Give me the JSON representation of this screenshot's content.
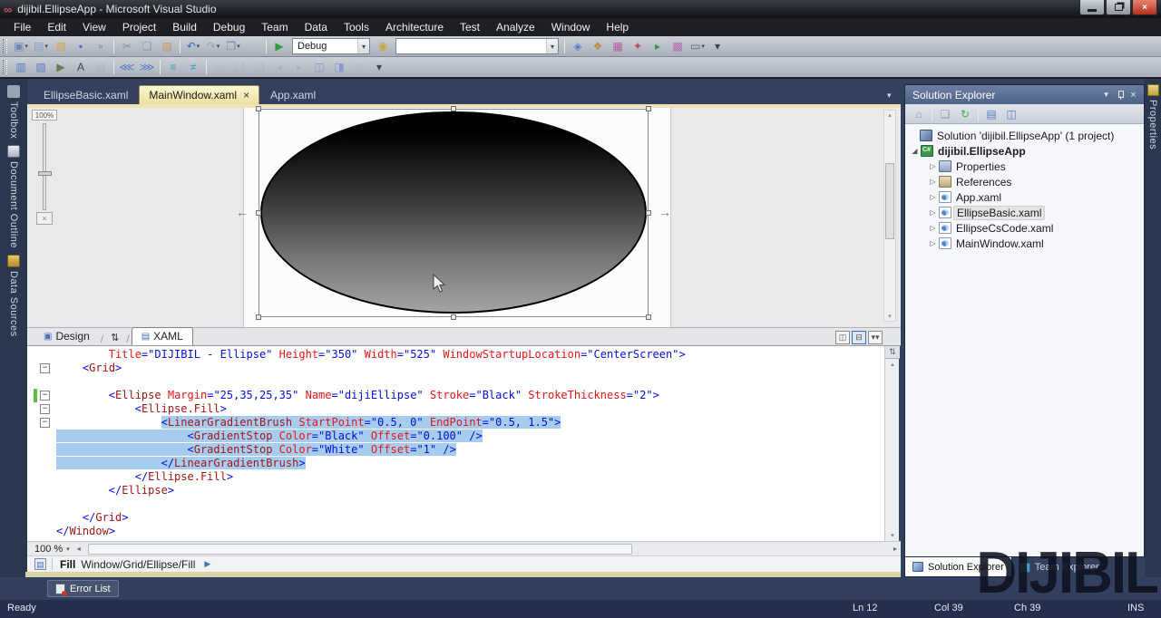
{
  "titlebar": {
    "title": "dijibil.EllipseApp - Microsoft Visual Studio"
  },
  "glyphs": {
    "vs_logo": "∞",
    "close": "×",
    "dropdown": "▾",
    "up": "▴",
    "down": "▾",
    "left": "◂",
    "right": "▸",
    "swap": "⇅",
    "fold_minus": "−",
    "expander_expanded": "◢",
    "expander_collapsed": "▷",
    "breadcrumb_play": "▶",
    "arrow_left": "←",
    "arrow_right": "→",
    "doc_dropdown": "▾",
    "split_vertical": "◫",
    "split_horizontal": "⊟",
    "collapse_pane": "▾▾",
    "fit_view": "×",
    "breadcrumb_doc": "▤",
    "resize_grip": "≡"
  },
  "menu": {
    "items": [
      "File",
      "Edit",
      "View",
      "Project",
      "Build",
      "Debug",
      "Team",
      "Data",
      "Tools",
      "Architecture",
      "Test",
      "Analyze",
      "Window",
      "Help"
    ]
  },
  "toolbar1": {
    "icons_left": [
      {
        "name": "new-project-icon",
        "g": "▣",
        "c": "#6f87b8",
        "dd": true
      },
      {
        "name": "add-item-icon",
        "g": "▤",
        "c": "#8a9ec4",
        "dd": true
      },
      {
        "name": "open-file-icon",
        "g": "▨",
        "c": "#d9a741"
      },
      {
        "name": "save-icon",
        "g": "▪",
        "c": "#4a6fb5"
      },
      {
        "name": "save-all-icon",
        "g": "▫",
        "c": "#4a6fb5"
      },
      {
        "sep": true
      },
      {
        "name": "cut-icon",
        "g": "✂",
        "c": "#7d8aa8"
      },
      {
        "name": "copy-icon",
        "g": "❏",
        "c": "#8a97b5"
      },
      {
        "name": "paste-icon",
        "g": "▧",
        "c": "#c49a5a"
      },
      {
        "sep": true
      },
      {
        "name": "undo-icon",
        "g": "↶",
        "c": "#3d63c2",
        "dd": true
      },
      {
        "name": "redo-icon",
        "g": "↷",
        "c": "#9aa5bd",
        "dd": true
      },
      {
        "name": "navigate-window-icon",
        "g": "❒",
        "c": "#6f87b8",
        "dd": true
      },
      {
        "name": "new-window-icon",
        "g": "❑",
        "c": "#b0b8c8",
        "d": true
      },
      {
        "sep": true
      },
      {
        "name": "start-debug-icon",
        "g": "▶",
        "c": "#2f9e3f"
      }
    ],
    "debug_combo": {
      "value": "Debug"
    },
    "find_icon": {
      "name": "find-symbol-icon",
      "g": "◉",
      "c": "#caa53f"
    },
    "search_combo": {
      "value": ""
    },
    "icons_right": [
      {
        "sep": true
      },
      {
        "name": "find-in-files-icon",
        "g": "◈",
        "c": "#5a7ec2"
      },
      {
        "name": "solution-explorer-icon",
        "g": "❖",
        "c": "#c08a3e"
      },
      {
        "name": "properties-window-icon",
        "g": "▦",
        "c": "#b55a9e"
      },
      {
        "name": "object-browser-icon",
        "g": "✦",
        "c": "#c2485a"
      },
      {
        "name": "start-page-icon",
        "g": "▸",
        "c": "#2f9e3f"
      },
      {
        "name": "extension-manager-icon",
        "g": "▩",
        "c": "#b56ab5"
      },
      {
        "name": "command-window-icon",
        "g": "▭",
        "c": "#5a6478",
        "dd": true
      },
      {
        "name": "toolbar-overflow-icon",
        "g": "▾",
        "c": "#3a4152"
      }
    ]
  },
  "toolbar2": {
    "icons": [
      {
        "name": "format-document-icon",
        "g": "▥",
        "c": "#5a7ec2"
      },
      {
        "name": "format-selection-icon",
        "g": "▧",
        "c": "#5a7ec2"
      },
      {
        "name": "pointer-icon",
        "g": "▶",
        "c": "#6a7a52"
      },
      {
        "name": "font-style-icon",
        "g": "A",
        "c": "#3a4152"
      },
      {
        "name": "copy-format-icon",
        "g": "▤",
        "c": "#9aa5bd",
        "d": true
      },
      {
        "sep": true
      },
      {
        "name": "indent-decrease-icon",
        "g": "⋘",
        "c": "#5a7ec2"
      },
      {
        "name": "indent-increase-icon",
        "g": "⋙",
        "c": "#5a7ec2"
      },
      {
        "sep": true
      },
      {
        "name": "comment-icon",
        "g": "≡",
        "c": "#3d9ec2"
      },
      {
        "name": "uncomment-icon",
        "g": "≠",
        "c": "#3d9ec2"
      },
      {
        "sep": true
      },
      {
        "name": "display-preview-icon",
        "g": "▭",
        "c": "#9aa5bd",
        "d": true
      },
      {
        "name": "balloon-1-icon",
        "g": "❏",
        "c": "#9aa5bd",
        "d": true
      },
      {
        "name": "balloon-2-icon",
        "g": "❑",
        "c": "#9aa5bd",
        "d": true
      },
      {
        "name": "navigate-back-icon",
        "g": "◂",
        "c": "#9aa5bd",
        "d": true
      },
      {
        "name": "navigate-forward-icon",
        "g": "▸",
        "c": "#9aa5bd",
        "d": true
      },
      {
        "name": "previous-bookmark-icon",
        "g": "◫",
        "c": "#8a97d0"
      },
      {
        "name": "next-bookmark-icon",
        "g": "◨",
        "c": "#8a97d0"
      },
      {
        "name": "clear-bookmarks-icon",
        "g": "◎",
        "c": "#9aa5bd",
        "d": true
      },
      {
        "name": "toolbar-overflow-icon",
        "g": "▾",
        "c": "#3a4152"
      }
    ]
  },
  "doc_tabs": {
    "tabs": [
      {
        "label": "EllipseBasic.xaml",
        "active": false
      },
      {
        "label": "MainWindow.xaml",
        "active": true,
        "closable": true
      },
      {
        "label": "App.xaml",
        "active": false
      }
    ]
  },
  "left_panel_tabs": [
    {
      "label": "Toolbox",
      "icon": "toolbox-icon"
    },
    {
      "label": "Document Outline",
      "icon": "document-outline-icon"
    },
    {
      "label": "Data Sources",
      "icon": "data-sources-icon"
    }
  ],
  "right_panel_tabs": [
    {
      "label": "Properties",
      "icon": "properties-icon"
    }
  ],
  "designer": {
    "zoom_label": "100%"
  },
  "editor_tabs": {
    "design_label": "Design",
    "xaml_label": "XAML"
  },
  "editor": {
    "zoom_value": "100 %",
    "lines": [
      {
        "indent": 8,
        "tokens": [
          [
            "a",
            "Title"
          ],
          [
            "d",
            "="
          ],
          [
            "v",
            "\"DIJIBIL - Ellipse\""
          ],
          [
            "p",
            " "
          ],
          [
            "a",
            "Height"
          ],
          [
            "d",
            "="
          ],
          [
            "v",
            "\"350\""
          ],
          [
            "p",
            " "
          ],
          [
            "a",
            "Width"
          ],
          [
            "d",
            "="
          ],
          [
            "v",
            "\"525\""
          ],
          [
            "p",
            " "
          ],
          [
            "a",
            "WindowStartupLocation"
          ],
          [
            "d",
            "="
          ],
          [
            "v",
            "\"CenterScreen\""
          ],
          [
            "d",
            ">"
          ]
        ]
      },
      {
        "indent": 4,
        "fold": true,
        "tokens": [
          [
            "d",
            "<"
          ],
          [
            "t",
            "Grid"
          ],
          [
            "d",
            ">"
          ]
        ]
      },
      {
        "indent": 0,
        "tokens": []
      },
      {
        "indent": 8,
        "fold": true,
        "change": true,
        "tokens": [
          [
            "d",
            "<"
          ],
          [
            "t",
            "Ellipse"
          ],
          [
            "p",
            " "
          ],
          [
            "a",
            "Margin"
          ],
          [
            "d",
            "="
          ],
          [
            "v",
            "\"25,35,25,35\""
          ],
          [
            "p",
            " "
          ],
          [
            "a",
            "Name"
          ],
          [
            "d",
            "="
          ],
          [
            "v",
            "\"dijiEllipse\""
          ],
          [
            "p",
            " "
          ],
          [
            "a",
            "Stroke"
          ],
          [
            "d",
            "="
          ],
          [
            "v",
            "\"Black\""
          ],
          [
            "p",
            " "
          ],
          [
            "a",
            "StrokeThickness"
          ],
          [
            "d",
            "="
          ],
          [
            "v",
            "\"2\""
          ],
          [
            "d",
            ">"
          ]
        ]
      },
      {
        "indent": 12,
        "fold": true,
        "tokens": [
          [
            "d",
            "<"
          ],
          [
            "t",
            "Ellipse.Fill"
          ],
          [
            "d",
            ">"
          ]
        ]
      },
      {
        "indent": 16,
        "fold": true,
        "sel": "text",
        "tokens": [
          [
            "d",
            "<"
          ],
          [
            "t",
            "LinearGradientBrush"
          ],
          [
            "p",
            " "
          ],
          [
            "a",
            "StartPoint"
          ],
          [
            "d",
            "="
          ],
          [
            "v",
            "\"0.5, 0\""
          ],
          [
            "p",
            " "
          ],
          [
            "a",
            "EndPoint"
          ],
          [
            "d",
            "="
          ],
          [
            "v",
            "\"0.5, 1.5\""
          ],
          [
            "d",
            ">"
          ]
        ]
      },
      {
        "indent": 20,
        "sel": "line",
        "tokens": [
          [
            "d",
            "<"
          ],
          [
            "t",
            "GradientStop"
          ],
          [
            "p",
            " "
          ],
          [
            "a",
            "Color"
          ],
          [
            "d",
            "="
          ],
          [
            "v",
            "\"Black\""
          ],
          [
            "p",
            " "
          ],
          [
            "a",
            "Offset"
          ],
          [
            "d",
            "="
          ],
          [
            "v",
            "\"0.100\""
          ],
          [
            "p",
            " "
          ],
          [
            "d",
            "/>"
          ]
        ]
      },
      {
        "indent": 20,
        "sel": "line",
        "tokens": [
          [
            "d",
            "<"
          ],
          [
            "t",
            "GradientStop"
          ],
          [
            "p",
            " "
          ],
          [
            "a",
            "Color"
          ],
          [
            "d",
            "="
          ],
          [
            "v",
            "\"White\""
          ],
          [
            "p",
            " "
          ],
          [
            "a",
            "Offset"
          ],
          [
            "d",
            "="
          ],
          [
            "v",
            "\"1\""
          ],
          [
            "p",
            " "
          ],
          [
            "d",
            "/>"
          ]
        ]
      },
      {
        "indent": 16,
        "sel": "line",
        "tokens": [
          [
            "d",
            "</"
          ],
          [
            "t",
            "LinearGradientBrush"
          ],
          [
            "d",
            ">"
          ]
        ]
      },
      {
        "indent": 12,
        "tokens": [
          [
            "d",
            "</"
          ],
          [
            "t",
            "Ellipse.Fill"
          ],
          [
            "d",
            ">"
          ]
        ]
      },
      {
        "indent": 8,
        "tokens": [
          [
            "d",
            "</"
          ],
          [
            "t",
            "Ellipse"
          ],
          [
            "d",
            ">"
          ]
        ]
      },
      {
        "indent": 0,
        "tokens": []
      },
      {
        "indent": 4,
        "tokens": [
          [
            "d",
            "</"
          ],
          [
            "t",
            "Grid"
          ],
          [
            "d",
            ">"
          ]
        ]
      },
      {
        "indent": 0,
        "tokens": [
          [
            "d",
            "</"
          ],
          [
            "t",
            "Window"
          ],
          [
            "d",
            ">"
          ]
        ]
      }
    ]
  },
  "breadcrumb": {
    "current": "Fill",
    "path": "Window/Grid/Ellipse/Fill"
  },
  "solution_explorer": {
    "title": "Solution Explorer",
    "toolbar_icons": [
      {
        "name": "collapse-all-icon",
        "g": "⌂",
        "c": "#8a97b5"
      },
      {
        "sep": true
      },
      {
        "name": "show-all-files-icon",
        "g": "❏",
        "c": "#8a97b5"
      },
      {
        "name": "refresh-icon",
        "g": "↻",
        "c": "#3fae49"
      },
      {
        "sep": true
      },
      {
        "name": "view-code-icon",
        "g": "▤",
        "c": "#5a7ec2"
      },
      {
        "name": "view-designer-icon",
        "g": "◫",
        "c": "#5a7ec2"
      }
    ],
    "tree": [
      {
        "label": "Solution 'dijibil.EllipseApp' (1 project)",
        "icon": "solution",
        "pad": 16,
        "expander": "none"
      },
      {
        "label": "dijibil.EllipseApp",
        "icon": "project",
        "pad": 4,
        "expander": "expanded",
        "bold": true
      },
      {
        "label": "Properties",
        "icon": "properties",
        "pad": 24,
        "expander": "collapsed"
      },
      {
        "label": "References",
        "icon": "references",
        "pad": 24,
        "expander": "collapsed"
      },
      {
        "label": "App.xaml",
        "icon": "xaml",
        "pad": 24,
        "expander": "collapsed"
      },
      {
        "label": "EllipseBasic.xaml",
        "icon": "xaml",
        "pad": 24,
        "expander": "collapsed",
        "highlight": true
      },
      {
        "label": "EllipseCsCode.xaml",
        "icon": "xaml",
        "pad": 24,
        "expander": "collapsed"
      },
      {
        "label": "MainWindow.xaml",
        "icon": "xaml",
        "pad": 24,
        "expander": "collapsed"
      }
    ],
    "bottom_tabs": [
      {
        "label": "Solution Explorer",
        "active": true,
        "icon": "mini-solx"
      },
      {
        "label": "Team Explorer",
        "active": false,
        "icon": "mini-team"
      }
    ]
  },
  "error_list": {
    "label": "Error List"
  },
  "status_bar": {
    "ready": "Ready",
    "line": "Ln 12",
    "column": "Col 39",
    "char": "Ch 39",
    "mode": "INS"
  },
  "watermark": {
    "text": "DIJIBIL"
  },
  "colors": {
    "selection": "#A6CDF0",
    "xml_tag": "#A31515",
    "xml_attribute": "#FF0000",
    "xml_value": "#0000FF",
    "xml_delimiter": "#0000FF",
    "active_tab": "#F2E4A4",
    "change_bar": "#5DBF3F",
    "debug_green": "#2F9E3F",
    "shell": "#34415E",
    "status_bar": "#252F4D",
    "gold_strip": "#EFE5B4"
  }
}
